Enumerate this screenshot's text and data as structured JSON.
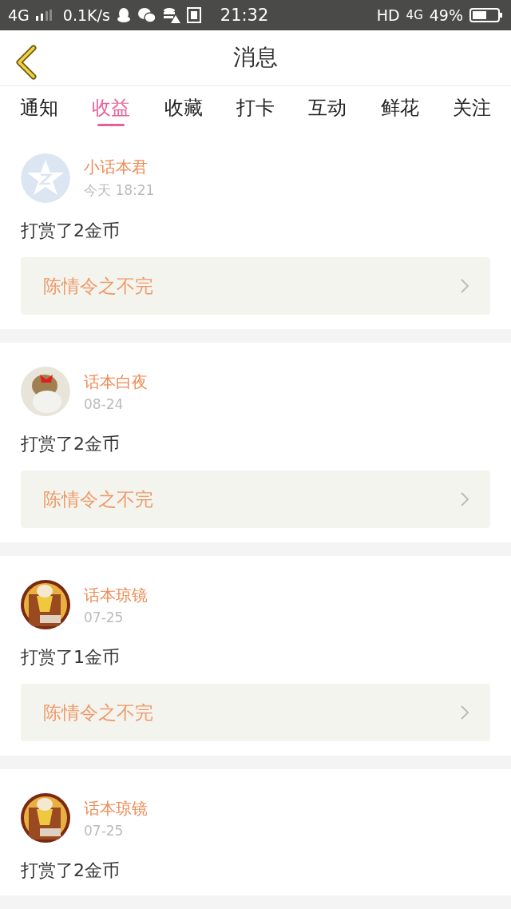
{
  "status_bar": {
    "network": "4G",
    "speed": "0.1K/s",
    "time": "21:32",
    "hd": "HD",
    "network_right": "4G",
    "battery": "49%"
  },
  "header": {
    "title": "消息"
  },
  "tabs": [
    {
      "label": "通知",
      "selected": false
    },
    {
      "label": "收益",
      "selected": true
    },
    {
      "label": "收藏",
      "selected": false
    },
    {
      "label": "打卡",
      "selected": false
    },
    {
      "label": "互动",
      "selected": false
    },
    {
      "label": "鲜花",
      "selected": false
    },
    {
      "label": "关注",
      "selected": false
    }
  ],
  "messages": [
    {
      "avatar": {
        "kind": "default"
      },
      "name": "小话本君",
      "time": "今天 18:21",
      "text": "打赏了2金币",
      "link": "陈情令之不完"
    },
    {
      "name": "话本白夜",
      "time": "08-24",
      "text": "打赏了2金币",
      "link": "陈情令之不完"
    },
    {
      "name": "话本琼镜",
      "time": "07-25",
      "text": "打赏了1金币",
      "link": "陈情令之不完"
    },
    {
      "name": "话本琼镜",
      "time": "07-25",
      "text": "打赏了2金币"
    }
  ]
}
